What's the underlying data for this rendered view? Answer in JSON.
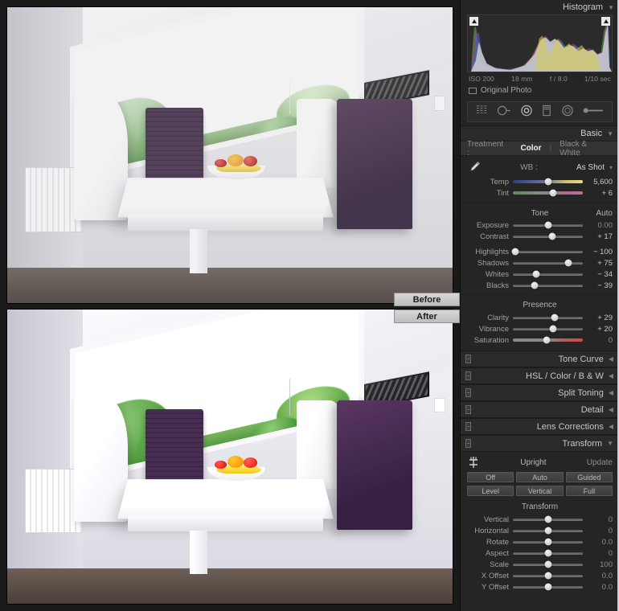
{
  "preview": {
    "before_label": "Before",
    "after_label": "After"
  },
  "histogram": {
    "title": "Histogram",
    "exif": {
      "iso": "ISO 200",
      "focal_length": "18 mm",
      "aperture": "f / 8.0",
      "shutter": "1/10 sec"
    },
    "original_photo_label": "Original Photo",
    "clipping_left": "shadow-clipping-indicator",
    "clipping_right": "highlight-clipping-indicator"
  },
  "tools": [
    {
      "name": "crop-overlay-tool"
    },
    {
      "name": "spot-removal-tool"
    },
    {
      "name": "red-eye-correction-tool"
    },
    {
      "name": "graduated-filter-tool"
    },
    {
      "name": "radial-filter-tool"
    },
    {
      "name": "adjustment-brush-tool"
    }
  ],
  "basic": {
    "title": "Basic",
    "treatment": {
      "label": "Treatment :",
      "options": [
        "Color",
        "Black & White"
      ],
      "selected": "Color"
    },
    "wb": {
      "label": "WB :",
      "value": "As Shot"
    },
    "wb_sliders": [
      {
        "name": "Temp",
        "value": "5,600",
        "pos": 50,
        "style": "temp"
      },
      {
        "name": "Tint",
        "value": "+ 6",
        "pos": 57,
        "style": "tint"
      }
    ],
    "tone": {
      "title": "Tone",
      "auto_label": "Auto",
      "sliders": [
        {
          "name": "Exposure",
          "value": "0.00",
          "pos": 50,
          "zero": true
        },
        {
          "name": "Contrast",
          "value": "+ 17",
          "pos": 56,
          "zero": false
        },
        {
          "name": "Highlights",
          "value": "− 100",
          "pos": 3,
          "zero": false
        },
        {
          "name": "Shadows",
          "value": "+ 75",
          "pos": 79,
          "zero": false
        },
        {
          "name": "Whites",
          "value": "− 34",
          "pos": 33,
          "zero": false
        },
        {
          "name": "Blacks",
          "value": "− 39",
          "pos": 31,
          "zero": false
        }
      ]
    },
    "presence": {
      "title": "Presence",
      "sliders": [
        {
          "name": "Clarity",
          "value": "+ 29",
          "pos": 60,
          "zero": false
        },
        {
          "name": "Vibrance",
          "value": "+ 20",
          "pos": 57,
          "zero": false
        },
        {
          "name": "Saturation",
          "value": "0",
          "pos": 48,
          "zero": true,
          "style": "sat"
        }
      ]
    }
  },
  "collapsed_panels": [
    {
      "title": "Tone Curve",
      "name": "tone-curve"
    },
    {
      "title": "HSL / Color / B & W",
      "name": "hsl-color-bw"
    },
    {
      "title": "Split Toning",
      "name": "split-toning"
    },
    {
      "title": "Detail",
      "name": "detail"
    },
    {
      "title": "Lens Corrections",
      "name": "lens-corrections"
    }
  ],
  "transform": {
    "title": "Transform",
    "upright": {
      "label": "Upright",
      "update_label": "Update",
      "buttons_row1": [
        "Off",
        "Auto",
        "Guided"
      ],
      "buttons_row2": [
        "Level",
        "Vertical",
        "Full"
      ]
    },
    "section_title": "Transform",
    "sliders": [
      {
        "name": "Vertical",
        "value": "0",
        "pos": 50,
        "zero": true
      },
      {
        "name": "Horizontal",
        "value": "0",
        "pos": 50,
        "zero": true
      },
      {
        "name": "Rotate",
        "value": "0.0",
        "pos": 50,
        "zero": true
      },
      {
        "name": "Aspect",
        "value": "0",
        "pos": 50,
        "zero": true
      },
      {
        "name": "Scale",
        "value": "100",
        "pos": 50,
        "zero": true
      },
      {
        "name": "X Offset",
        "value": "0.0",
        "pos": 50,
        "zero": true
      },
      {
        "name": "Y Offset",
        "value": "0.0",
        "pos": 50,
        "zero": true
      }
    ]
  },
  "colors": {
    "panel_bg": "#252525",
    "section_bg": "#2e2e2e",
    "text": "#b0b0b0",
    "accent_text": "#d8d8d8"
  }
}
